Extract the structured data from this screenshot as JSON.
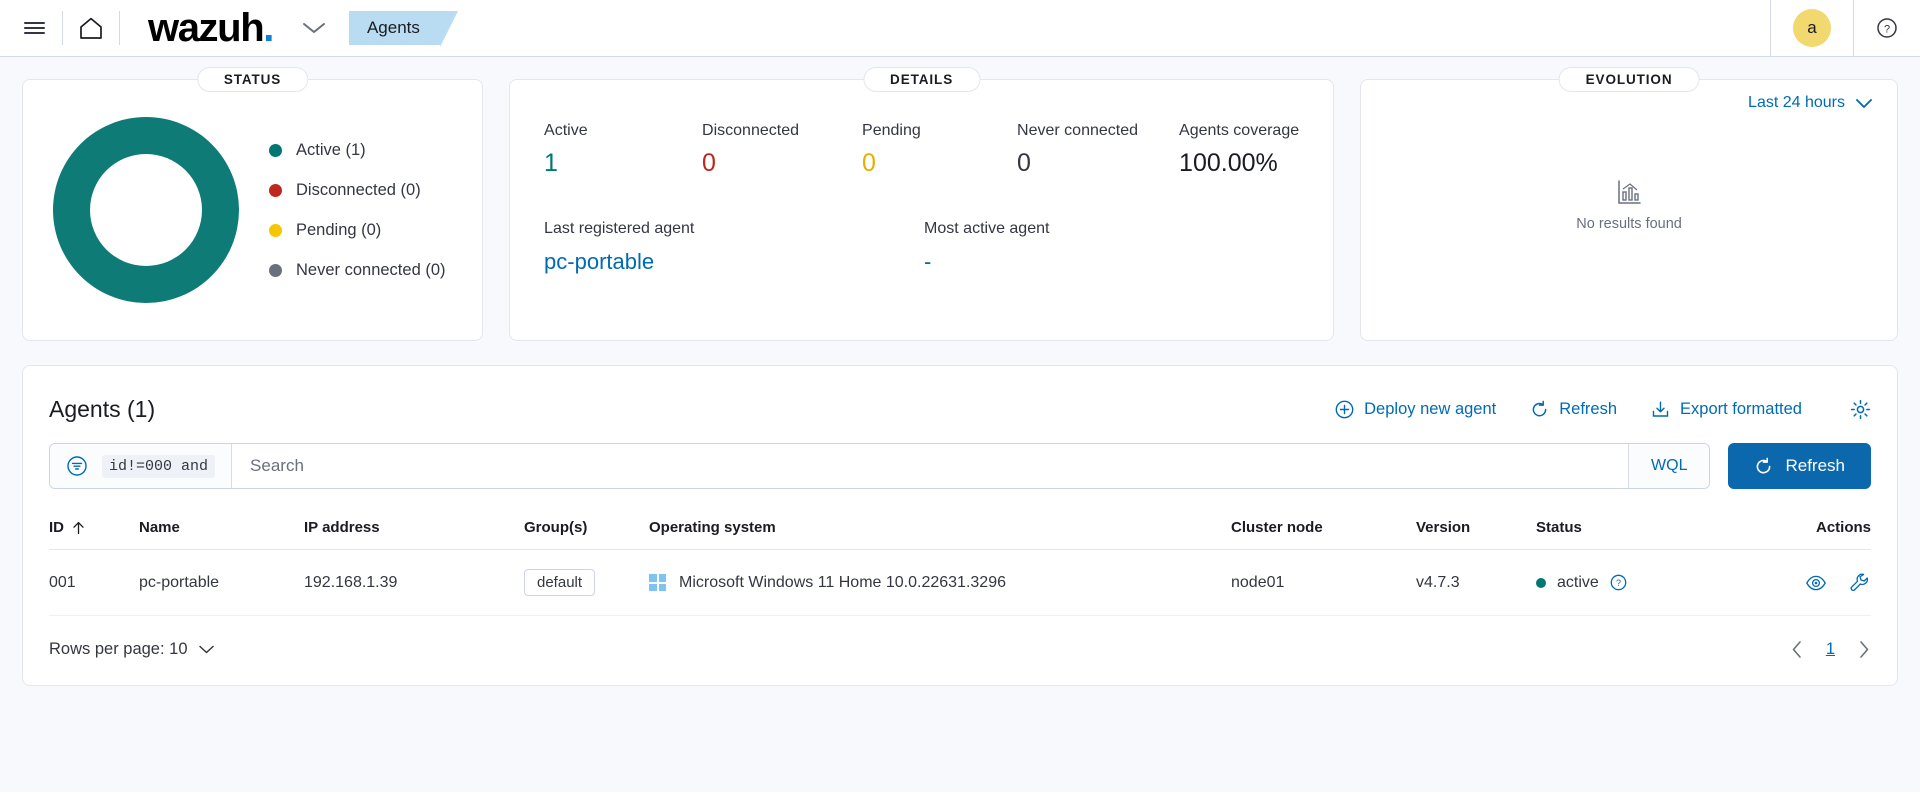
{
  "header": {
    "menu_icon": "hamburger-menu-icon",
    "home_icon": "home-icon",
    "brand": "wazuh",
    "brand_dot": ".",
    "brand_caret_icon": "chevron-down-icon",
    "active_tab": "Agents",
    "avatar_initial": "a",
    "help_icon": "question-circle-icon"
  },
  "status_panel": {
    "title": "STATUS",
    "legend": [
      {
        "label": "Active (1)",
        "color": "#007871"
      },
      {
        "label": "Disconnected (0)",
        "color": "#bd271e"
      },
      {
        "label": "Pending (0)",
        "color": "#f5c700"
      },
      {
        "label": "Never connected (0)",
        "color": "#6a717d"
      }
    ]
  },
  "details_panel": {
    "title": "DETAILS",
    "metrics": [
      {
        "label": "Active",
        "value": "1",
        "color": "#007871"
      },
      {
        "label": "Disconnected",
        "value": "0",
        "color": "#bd271e"
      },
      {
        "label": "Pending",
        "value": "0",
        "color": "#e5b000"
      },
      {
        "label": "Never connected",
        "value": "0",
        "color": "#343741"
      },
      {
        "label": "Agents coverage",
        "value": "100.00%",
        "color": "#1a1c21"
      }
    ],
    "last_registered_label": "Last registered agent",
    "last_registered_value": "pc-portable",
    "most_active_label": "Most active agent",
    "most_active_value": "-"
  },
  "evolution_panel": {
    "title": "EVOLUTION",
    "range_label": "Last 24 hours",
    "range_caret_icon": "chevron-down-icon",
    "empty_icon": "bar-chart-icon",
    "empty_text": "No results found"
  },
  "agents_section": {
    "title": "Agents (1)",
    "actions": [
      {
        "label": "Deploy new agent",
        "icon": "plus-circle-icon"
      },
      {
        "label": "Refresh",
        "icon": "refresh-icon"
      },
      {
        "label": "Export formatted",
        "icon": "download-icon"
      }
    ],
    "settings_icon": "gear-icon",
    "search": {
      "filter_icon": "filter-icon",
      "filter_chip": "id!=000 and",
      "placeholder": "Search",
      "value": "",
      "wql_label": "WQL",
      "refresh_button": "Refresh",
      "refresh_icon": "refresh-icon"
    },
    "table": {
      "columns": [
        "ID",
        "Name",
        "IP address",
        "Group(s)",
        "Operating system",
        "Cluster node",
        "Version",
        "Status",
        "Actions"
      ],
      "sort_column": "ID",
      "sort_icon": "arrow-up-icon",
      "rows": [
        {
          "id": "001",
          "name": "pc-portable",
          "ip": "192.168.1.39",
          "group": "default",
          "os": "Microsoft Windows 11 Home 10.0.22631.3296",
          "os_icon": "windows-logo-icon",
          "cluster_node": "node01",
          "version": "v4.7.3",
          "status": "active",
          "status_color": "#007871",
          "status_help_icon": "question-circle-icon",
          "action_view_icon": "eye-icon",
          "action_config_icon": "wrench-icon"
        }
      ]
    },
    "footer": {
      "rows_per_page_label": "Rows per page: 10",
      "rows_per_page_caret_icon": "chevron-down-icon",
      "prev_icon": "chevron-left-icon",
      "page_number": "1",
      "next_icon": "chevron-right-icon"
    }
  }
}
